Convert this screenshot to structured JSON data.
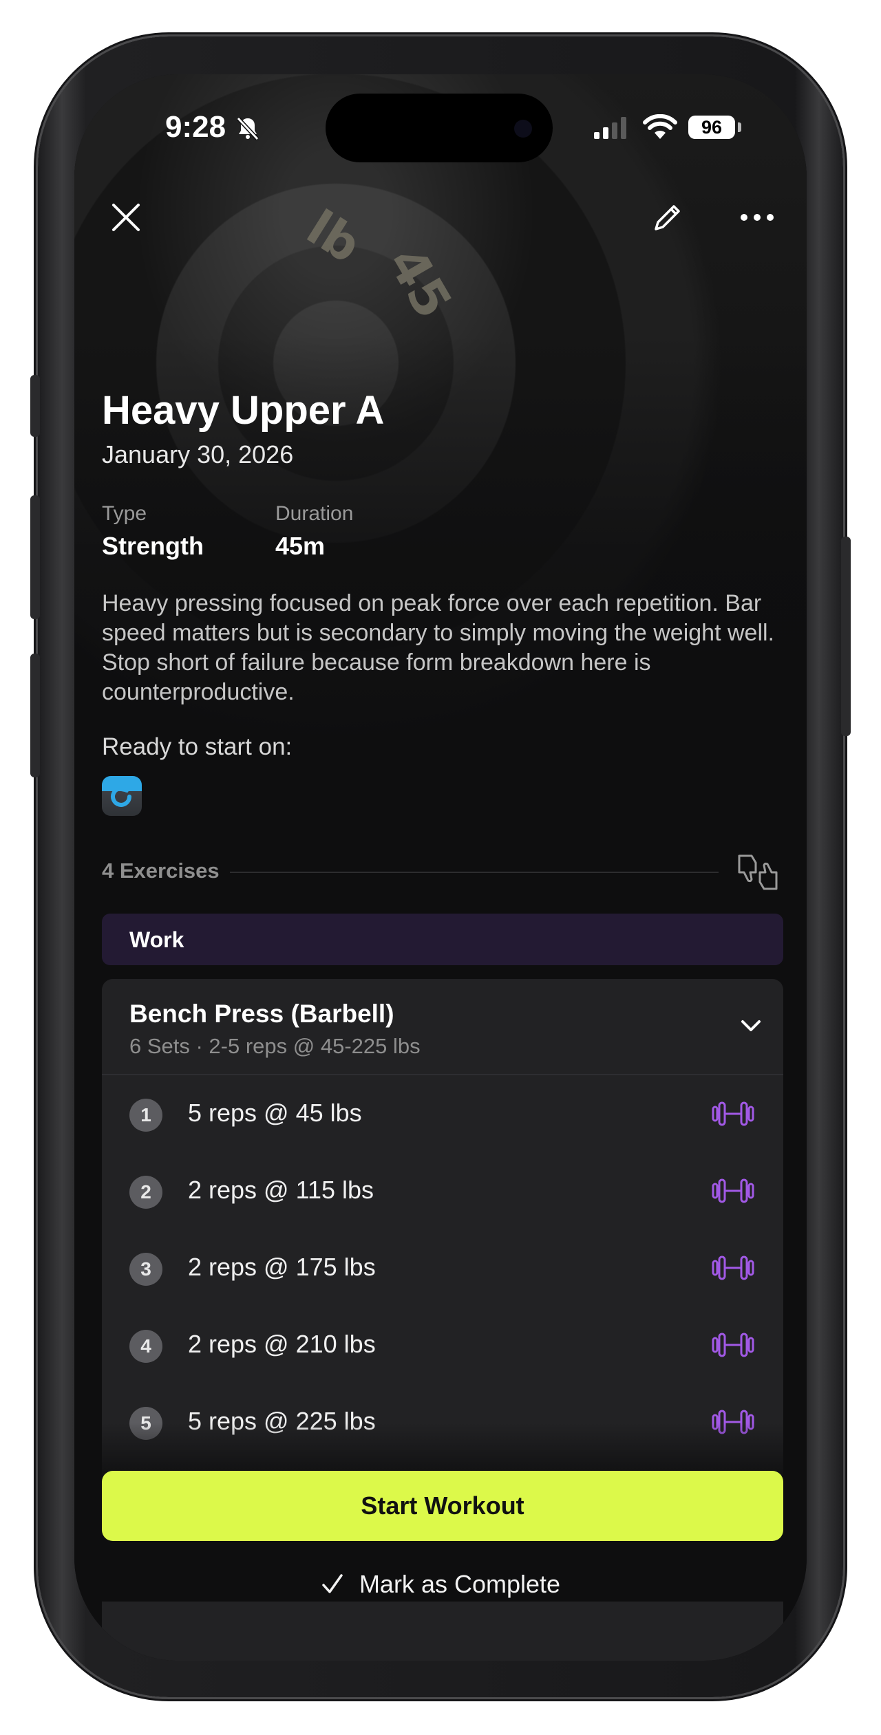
{
  "status_bar": {
    "time": "9:28",
    "battery": "96"
  },
  "hero": {
    "plate_number": "45",
    "plate_unit": "lb"
  },
  "workout": {
    "title": "Heavy Upper A",
    "date": "January 30, 2026",
    "type_label": "Type",
    "type_value": "Strength",
    "duration_label": "Duration",
    "duration_value": "45m",
    "description": "Heavy pressing focused on peak force over each repetition. Bar speed matters but is secondary to simply moving the weight well. Stop short of failure because form breakdown here is counterproductive.",
    "ready_label": "Ready to start on:",
    "app_icon": "connect-app-icon"
  },
  "exercises": {
    "count_label": "4 Exercises",
    "section": "Work",
    "items": [
      {
        "name": "Bench Press (Barbell)",
        "summary": "6 Sets · 2-5 reps @ 45-225 lbs",
        "sets": [
          {
            "num": "1",
            "text": "5 reps @ 45 lbs"
          },
          {
            "num": "2",
            "text": "2 reps @ 115 lbs"
          },
          {
            "num": "3",
            "text": "2 reps @ 175 lbs"
          },
          {
            "num": "4",
            "text": "2 reps @ 210 lbs"
          },
          {
            "num": "5",
            "text": "5 reps @ 225 lbs"
          }
        ]
      }
    ]
  },
  "actions": {
    "start": "Start Workout",
    "complete": "Mark as Complete"
  },
  "colors": {
    "accent": "#dcf94a",
    "section_bg": "#231a33",
    "dumbbell": "#a259e6",
    "background": "#0e0e0f"
  }
}
